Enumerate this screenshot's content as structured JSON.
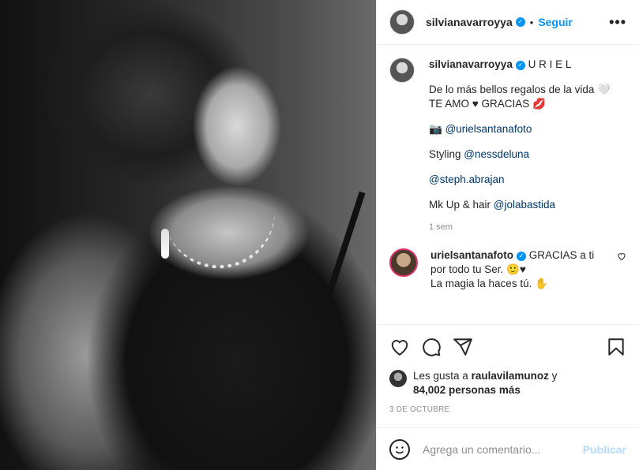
{
  "post": {
    "username": "silvianavarroyya",
    "follow_label": "Seguir",
    "dot": "•",
    "more_label": "•••"
  },
  "caption": {
    "username": "silvianavarroyya",
    "title": "U R I E L",
    "line1": "De lo más bellos regalos de la vida 🤍 TE AMO ♥ GRACIAS 💋",
    "line2_prefix": "📷 ",
    "line2_link": "@urielsantanafoto",
    "line3_prefix": "Styling ",
    "line3_link": "@nessdeluna",
    "line4_link": "@steph.abrajan",
    "line5_prefix": "Mk Up & hair ",
    "line5_link": "@jolabastida",
    "time": "1 sem"
  },
  "comment": {
    "username": "urielsantanafoto",
    "text": "GRACIAS a ti por todo tu Ser. 🙂♥",
    "text2": "La magia la haces tú. ✋"
  },
  "likes": {
    "prefix": "Les gusta a ",
    "user": "raulavilamunoz",
    "middle": " y ",
    "count": "84,002 personas más"
  },
  "date": "3 DE OCTUBRE",
  "add_comment": {
    "placeholder": "Agrega un comentario...",
    "publish_label": "Publicar"
  },
  "colors": {
    "accent": "#0095f6",
    "publish_disabled": "#b3dbff"
  },
  "icons": [
    "heart-icon",
    "comment-icon",
    "share-icon",
    "bookmark-icon",
    "emoji-icon",
    "verified-icon"
  ]
}
